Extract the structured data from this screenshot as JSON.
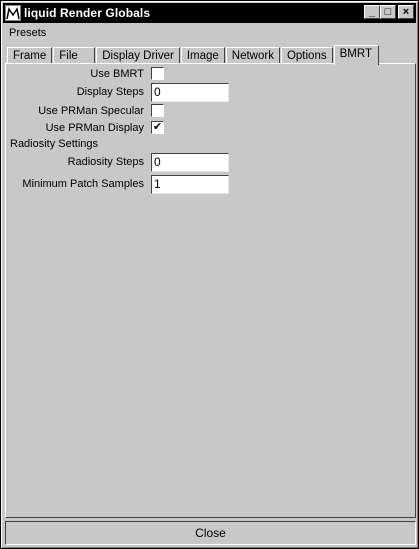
{
  "window": {
    "title": "liquid Render Globals"
  },
  "title_buttons": {
    "minimize": "_",
    "maximize": "□",
    "close": "×"
  },
  "menu": {
    "items": [
      "Presets"
    ]
  },
  "tabs": [
    "Frame",
    "File",
    "Display Driver",
    "Image",
    "Network",
    "Options",
    "BMRT"
  ],
  "active_tab": "BMRT",
  "form": {
    "use_bmrt": {
      "label": "Use BMRT",
      "checked": false
    },
    "display_steps": {
      "label": "Display Steps",
      "value": "0"
    },
    "use_prman_specular": {
      "label": "Use PRMan Specular",
      "checked": false
    },
    "use_prman_display": {
      "label": "Use PRMan Display",
      "checked": true
    },
    "radiosity_section": "Radiosity Settings",
    "radiosity_steps": {
      "label": "Radiosity Steps",
      "value": "0"
    },
    "min_patch_samples": {
      "label": "Minimum Patch Samples",
      "value": "1"
    }
  },
  "footer": {
    "close_label": "Close"
  },
  "checkmark": "✔"
}
